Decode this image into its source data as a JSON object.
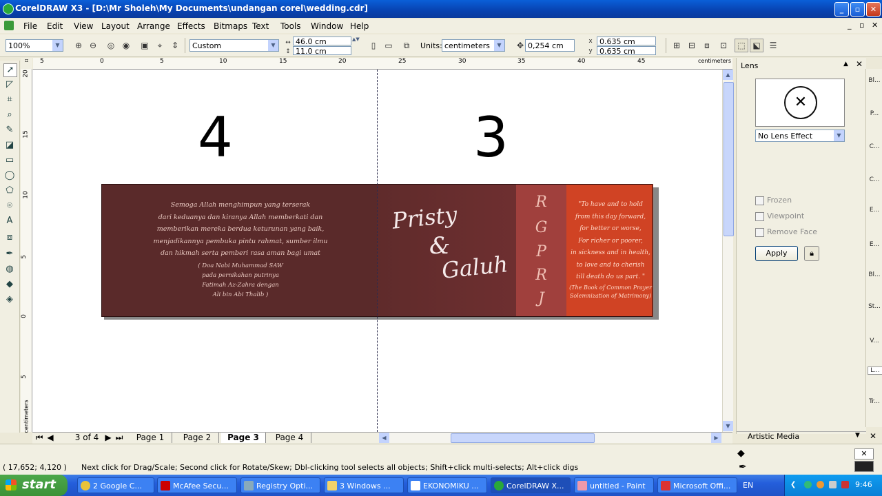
{
  "window": {
    "title": "CorelDRAW X3 - [D:\\Mr Sholeh\\My Documents\\undangan corel\\wedding.cdr]",
    "minimize": "_",
    "maximize": "▫",
    "close": "✕"
  },
  "menu": [
    "File",
    "Edit",
    "View",
    "Layout",
    "Arrange",
    "Effects",
    "Bitmaps",
    "Text",
    "Tools",
    "Window",
    "Help"
  ],
  "toolbar": {
    "zoom": "100%",
    "page_size": "Custom",
    "width": "46.0 cm",
    "height": "11.0 cm",
    "units_label": "Units:",
    "units": "centimeters",
    "nudge": "0,254 cm",
    "dup_x": "0.635 cm",
    "dup_y": "0.635 cm"
  },
  "ruler": {
    "h_ticks": [
      "5",
      "0",
      "5",
      "10",
      "15",
      "20",
      "25",
      "30",
      "35",
      "40",
      "45"
    ],
    "h_unit": "centimeters",
    "v_ticks": [
      "20",
      "15",
      "10",
      "5",
      "0",
      "5"
    ],
    "v_unit": "centimeters"
  },
  "canvas": {
    "label_left": "4",
    "label_right": "3",
    "verse_lines": [
      "Semoga Allah menghimpun yang terserak",
      "dari keduanya dan kiranya Allah memberkati dan",
      "memberikan mereka berdua keturunan yang baik,",
      "menjadikannya pembuka pintu rahmat, sumber ilmu",
      "dan hikmah serta pemberi rasa aman bagi umat"
    ],
    "verse_source": [
      "( Doa Nabi Muhammad SAW",
      "pada pernikahan putrinya",
      "Fatimah Az-Zahra dengan",
      "Ali bin Abi Thalib )"
    ],
    "name1": "Pristy",
    "ampersand": "&",
    "name2": "Galuh",
    "monogram": [
      "R",
      "G",
      "P",
      "R",
      "J"
    ],
    "vow_lines": [
      "\"To have and to hold",
      "from this day forward,",
      "for better or worse,",
      "For richer or poorer,",
      "in sickness and in health,",
      "to love and to cherish",
      "till death do us part. \""
    ],
    "vow_source": [
      "(The Book of Common Prayer",
      "Solemnization of Matrimony)"
    ]
  },
  "pages": {
    "counter": "3 of 4",
    "tabs": [
      "Page 1",
      "Page 2",
      "Page 3",
      "Page 4"
    ],
    "active": "Page 3"
  },
  "docker": {
    "title": "Lens",
    "lens_effect": "No Lens Effect",
    "frozen": "Frozen",
    "viewpoint": "Viewpoint",
    "remove_face": "Remove Face",
    "apply": "Apply",
    "artistic_media": "Artistic Media",
    "tabs": [
      "Bl...",
      "P...",
      "C...",
      "C...",
      "E...",
      "E...",
      "Bl...",
      "St...",
      "V...",
      "L...",
      "Tr..."
    ]
  },
  "status": {
    "coords": "( 17,652; 4,120 )",
    "message": "Next click for Drag/Scale; Second click for Rotate/Skew; Dbl-clicking tool selects all objects; Shift+click multi-selects; Alt+click digs"
  },
  "taskbar": {
    "start": "start",
    "tasks": [
      "2 Google C...",
      "McAfee Secu...",
      "Registry Opti...",
      "3 Windows ...",
      "EKONOMIKU ...",
      "CorelDRAW X...",
      "untitled - Paint",
      "Microsoft Offi..."
    ],
    "active_task": "CorelDRAW X...",
    "lang": "EN",
    "clock": "9:46"
  }
}
